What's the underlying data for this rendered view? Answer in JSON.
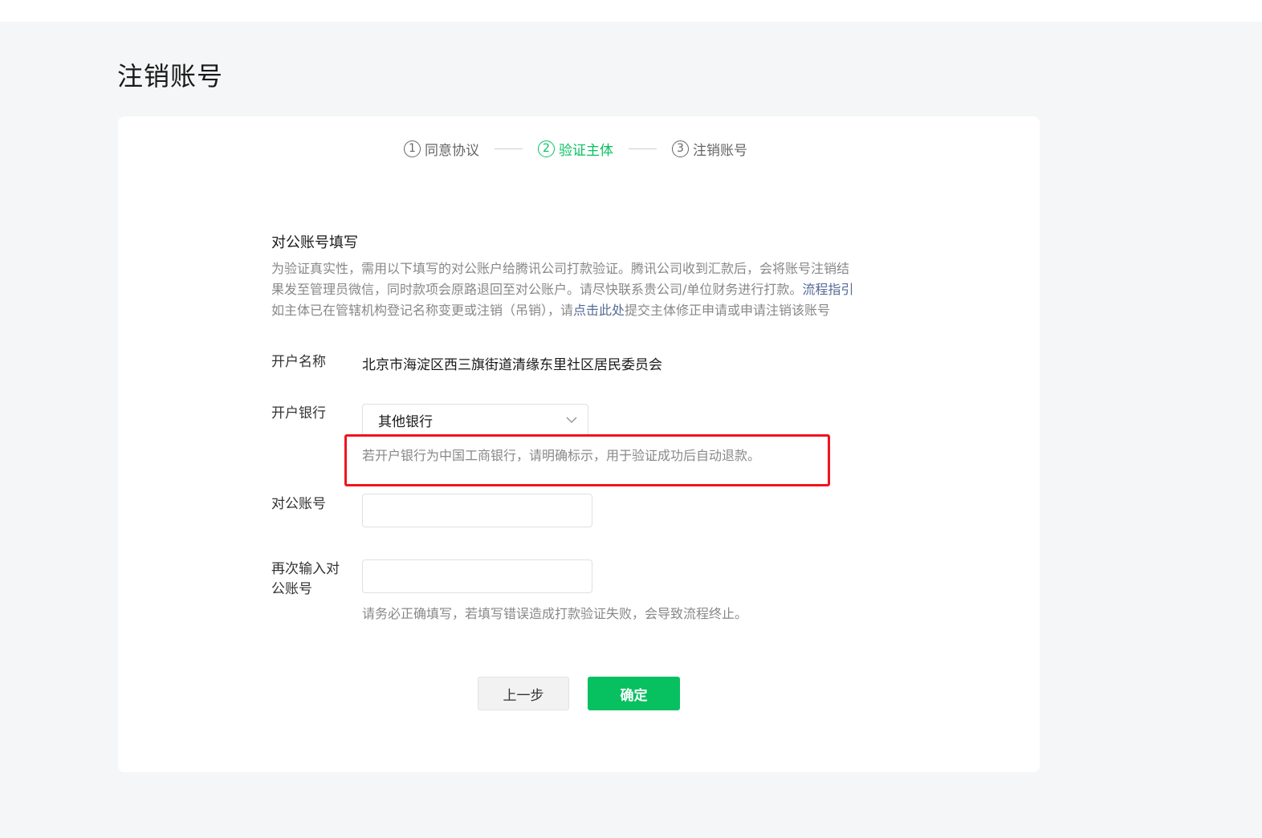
{
  "page": {
    "title": "注销账号"
  },
  "steps": [
    {
      "num": "1",
      "label": "同意协议"
    },
    {
      "num": "2",
      "label": "验证主体"
    },
    {
      "num": "3",
      "label": "注销账号"
    }
  ],
  "section": {
    "title": "对公账号填写",
    "desc_line1": "为验证真实性，需用以下填写的对公账户给腾讯公司打款验证。腾讯公司收到汇款后，会将账号注销结",
    "desc_line2_text": "果发至管理员微信，同时款项会原路退回至对公账户。请尽快联系贵公司/单位财务进行打款。",
    "desc_line2_link": "流程指引",
    "desc_line3_pre": "如主体已在管辖机构登记名称变更或注销（吊销），请",
    "desc_line3_link": "点击此处",
    "desc_line3_post": "提交主体修正申请或申请注销该账号"
  },
  "form": {
    "account_name_label": "开户名称",
    "account_name_value": "北京市海淀区西三旗街道清缘东里社区居民委员会",
    "bank_label": "开户银行",
    "bank_selected": "其他银行",
    "bank_hint": "若开户银行为中国工商银行，请明确标示，用于验证成功后自动退款。",
    "account_no_label": "对公账号",
    "account_no_value": "",
    "confirm_label": "再次输入对公账号",
    "confirm_value": "",
    "confirm_hint": "请务必正确填写，若填写错误造成打款验证失败，会导致流程终止。"
  },
  "buttons": {
    "back": "上一步",
    "ok": "确定"
  },
  "colors": {
    "accent": "#07c160",
    "highlight": "#f0141e",
    "link": "#576b95"
  }
}
